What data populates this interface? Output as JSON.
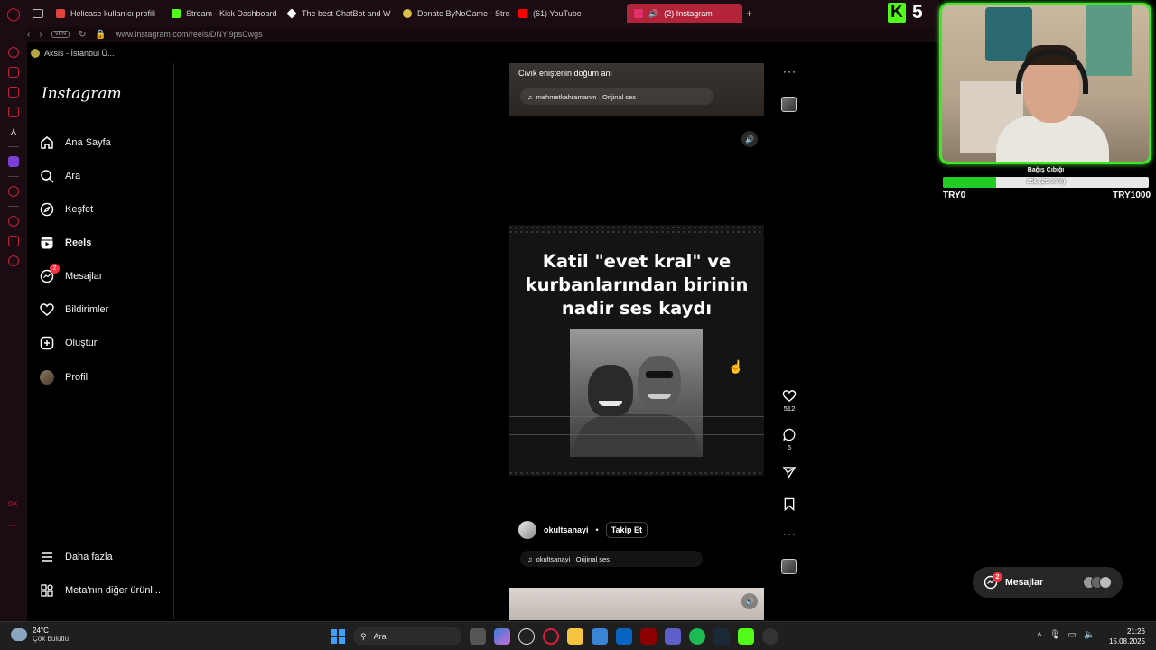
{
  "browser": {
    "tabs": [
      {
        "title": "Helicase kullanıcı profili",
        "color": "#e0443a"
      },
      {
        "title": "Stream - Kick Dashboard",
        "color": "#53fc18"
      },
      {
        "title": "The best ChatBot and W",
        "color": "#ffffff"
      },
      {
        "title": "Donate ByNoGame - Stre",
        "color": "#d8c04a"
      },
      {
        "title": "(61) YouTube",
        "color": "#ff0000"
      },
      {
        "title": "(2) Instagram",
        "color": "#e1306c",
        "active": true
      }
    ],
    "url": "www.instagram.com/reels/DNYi9psCwgs",
    "vpn_label": "VPN",
    "bookmark": "Aksis - İstanbul Ü..."
  },
  "instagram": {
    "logo": "Instagram",
    "nav": [
      {
        "label": "Ana Sayfa",
        "icon": "home-icon"
      },
      {
        "label": "Ara",
        "icon": "search-icon"
      },
      {
        "label": "Keşfet",
        "icon": "compass-icon"
      },
      {
        "label": "Reels",
        "icon": "reels-icon",
        "active": true
      },
      {
        "label": "Mesajlar",
        "icon": "messenger-icon",
        "badge": "2"
      },
      {
        "label": "Bildirimler",
        "icon": "heart-icon"
      },
      {
        "label": "Oluştur",
        "icon": "plus-square-icon"
      },
      {
        "label": "Profil",
        "icon": "avatar"
      }
    ],
    "more": "Daha fazla",
    "meta": "Meta'nın diğer ürünl..."
  },
  "reels": {
    "prev": {
      "caption": "Cıvık eniştenin doğum anı",
      "audio": "mehmetkahramanm · Orijinal ses"
    },
    "current": {
      "overlay_title": "Katil \"evet kral\" ve kurbanlarından birinin nadir ses kaydı",
      "likes": "512",
      "comments": "6",
      "author": "okultsanayi",
      "separator": "•",
      "follow": "Takip Et",
      "audio": "okultsanayi · Orijinal ses"
    }
  },
  "messages_pill": {
    "label": "Mesajlar",
    "badge": "2"
  },
  "stream": {
    "kick_count": "5",
    "donation_title": "Bağış Çıbığı",
    "donation_text": "25₺ (25.90%)",
    "donation_progress": 0.259,
    "min": "TRY0",
    "max": "TRY1000"
  },
  "taskbar": {
    "temp": "24°C",
    "weather": "Çok bulutlu",
    "search": "Ara",
    "time": "21:26",
    "date": "15.08.2025"
  }
}
